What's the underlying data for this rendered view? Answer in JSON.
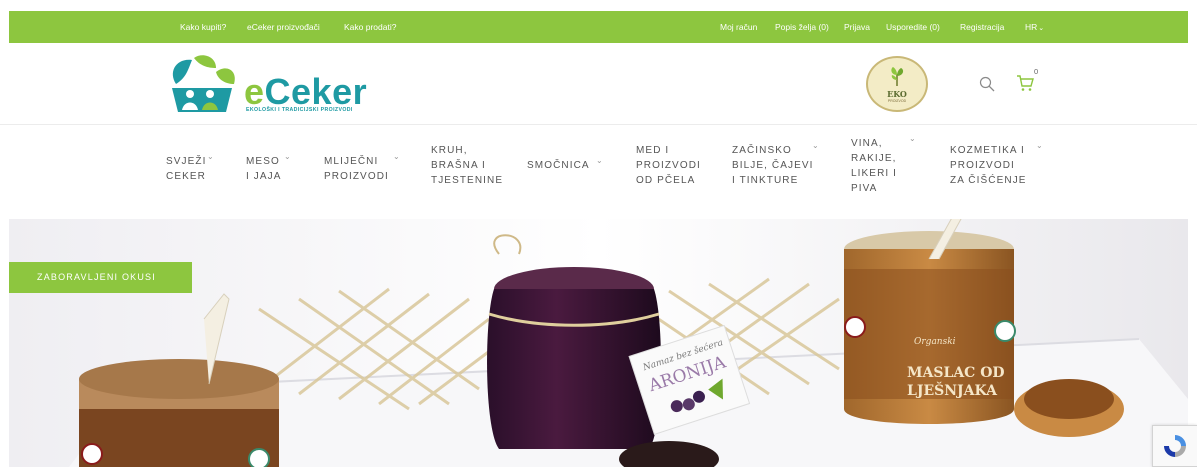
{
  "topbar": {
    "left_links": [
      "Kako kupiti?",
      "eCeker proizvođači",
      "Kako prodati?"
    ],
    "right_links": [
      "Moj račun",
      "Popis želja (0)",
      "Prijava",
      "Usporedite (0)",
      "Registracija",
      "HR"
    ]
  },
  "logo": {
    "word_e": "e",
    "word_rest": "Ceker",
    "tagline": "EKOLOŠKI I TRADICIJSKI PROIZVODI"
  },
  "eko_badge": {
    "text": "EKO",
    "sub": "PROIZVOD"
  },
  "cart": {
    "count": "0"
  },
  "nav": [
    {
      "label": "SVJEŽI\nCEKER",
      "has_dropdown": true
    },
    {
      "label": "MESO\nI JAJA",
      "has_dropdown": true
    },
    {
      "label": "MLIJEČNI\nPROIZVODI",
      "has_dropdown": true
    },
    {
      "label": "KRUH,\nBRAŠNA I\nTJESTENINE",
      "has_dropdown": false
    },
    {
      "label": "SMOČNICA",
      "has_dropdown": true
    },
    {
      "label": "MED I\nPROIZVODI\nOD PČELA",
      "has_dropdown": false
    },
    {
      "label": "ZAČINSKO\nBILJE, ČAJEVI\nI TINKTURE",
      "has_dropdown": true
    },
    {
      "label": "VINA,\nRAKIJE,\nLIKERI I\nPIVA",
      "has_dropdown": true
    },
    {
      "label": "KOZMETIKA I\nPROIZVODI\nZA ČIŠĆENJE",
      "has_dropdown": true
    }
  ],
  "hero": {
    "badge": "ZABORAVLJENI OKUSI",
    "jar_label_1": "Namaz bez šećera",
    "jar_label_2": "ARONIJA",
    "jar3_small": "Organski",
    "jar3_big_1": "MASLAC OD",
    "jar3_big_2": "LJEŠNJAKA"
  },
  "colors": {
    "brand_green": "#8dc63f",
    "brand_teal": "#1e9aa3"
  },
  "icons": [
    "search-icon",
    "cart-icon",
    "chevron-down-icon",
    "logo-icon",
    "recaptcha-icon"
  ]
}
